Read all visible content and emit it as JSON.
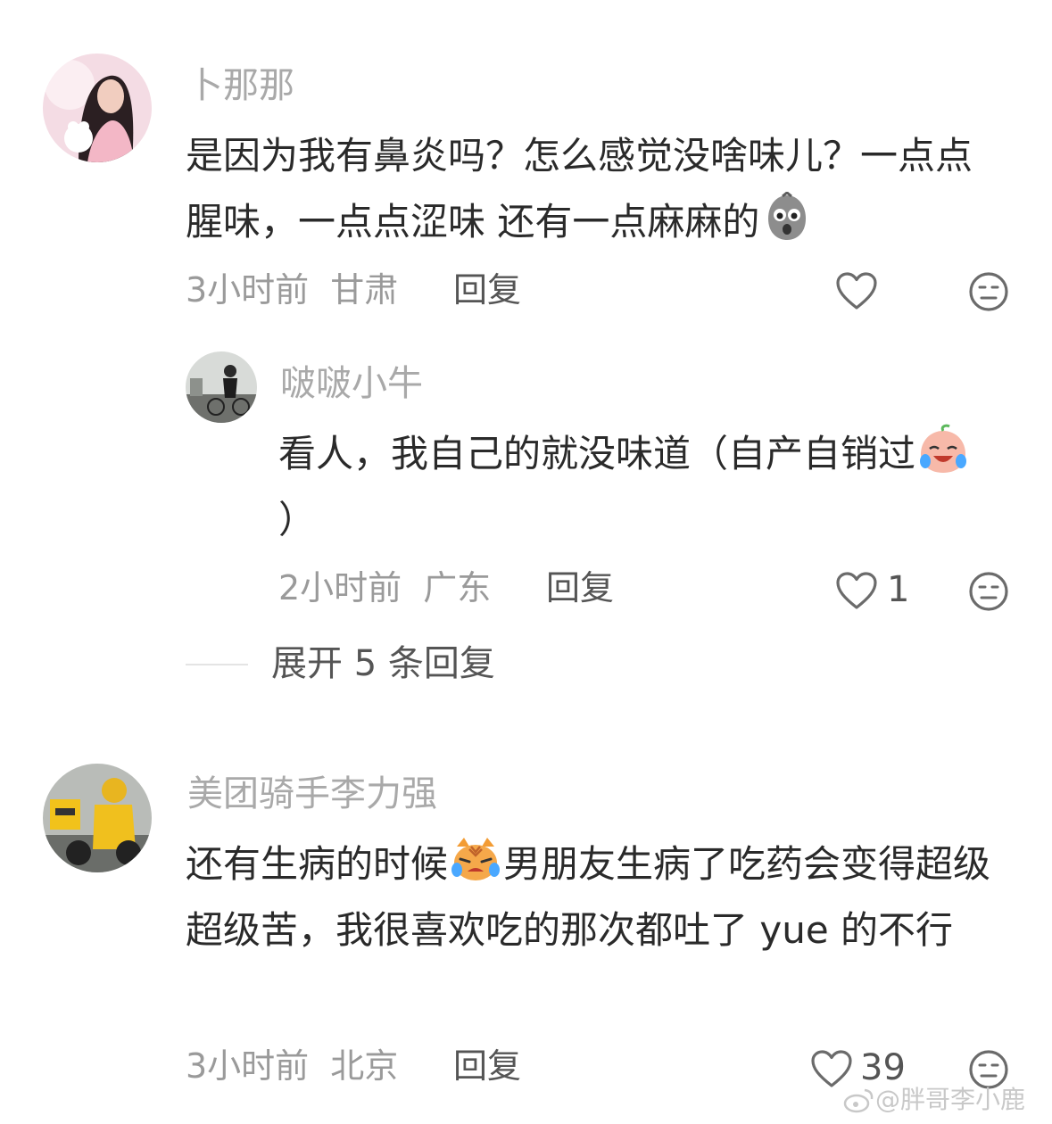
{
  "comments": [
    {
      "username": "卜那那",
      "text_before_emoji": "是因为我有鼻炎吗？怎么感觉没啥味儿？一点点腥味，一点点涩味 还有一点麻麻的",
      "emoji": "shocked-potato-emoji",
      "time": "3小时前",
      "location": "甘肃",
      "reply_label": "回复",
      "likes": ""
    },
    {
      "username": "啵啵小牛",
      "text_before_emoji": "看人，我自己的就没味道（自产自销过",
      "emoji": "crying-laughing-peach-emoji",
      "text_after_emoji": "）",
      "time": "2小时前",
      "location": "广东",
      "reply_label": "回复",
      "likes": "1"
    },
    {
      "username": "美团骑手李力强",
      "text_part1": "还有生病的时候",
      "emoji": "crying-cat-emoji",
      "text_part2": "男朋友生病了吃药会变得超级超级苦，我很喜欢吃的那次都吐了 yue 的不行",
      "time": "3小时前",
      "location": "北京",
      "reply_label": "回复",
      "likes": "39"
    }
  ],
  "expand_replies": "展开 5 条回复",
  "watermark": "@胖哥李小鹿",
  "colors": {
    "name": "#a9a9a9",
    "text": "#2a2a2a",
    "meta": "#9a9a9a",
    "icon": "#6b6b6b"
  }
}
